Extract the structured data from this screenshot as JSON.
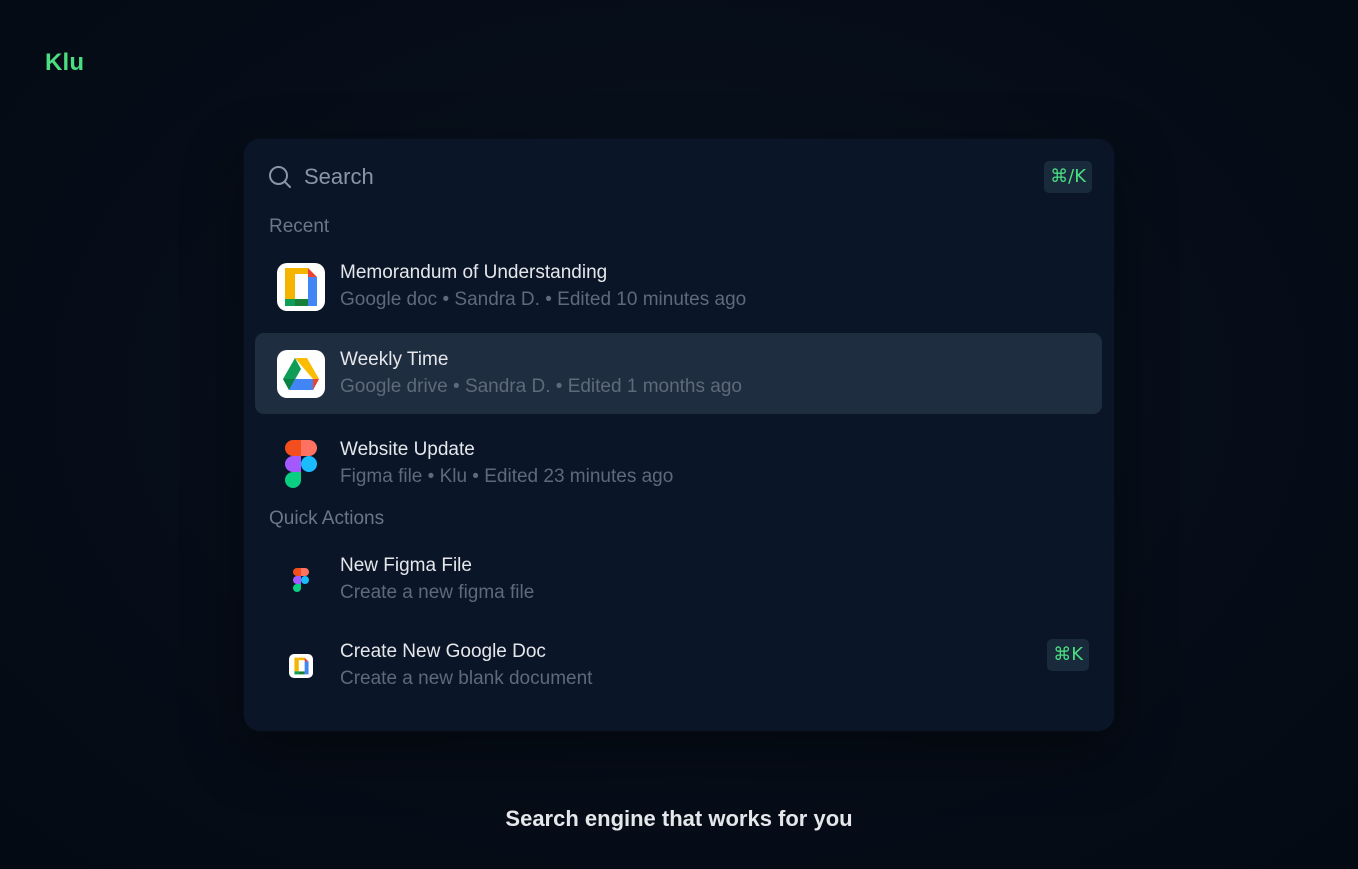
{
  "app": {
    "logo": "Klu",
    "tagline": "Search engine that works for you"
  },
  "colors": {
    "accent": "#4ade80",
    "panel": "#0a1628",
    "selected_row": "#1f2d40"
  },
  "search": {
    "placeholder": "Search",
    "value": "",
    "shortcut": "⌘/K",
    "icon": "search-icon"
  },
  "recent": {
    "label": "Recent",
    "items": [
      {
        "title": "Memorandum of Understanding",
        "subtitle": "Google doc • Sandra D. • Edited 10 minutes ago",
        "icon": "google-docs-icon"
      },
      {
        "title": "Weekly Time",
        "subtitle": "Google drive • Sandra D. • Edited 1 months ago",
        "icon": "google-drive-icon",
        "selected": true
      },
      {
        "title": "Website Update",
        "subtitle": "Figma file • Klu • Edited 23 minutes ago",
        "icon": "figma-icon"
      }
    ]
  },
  "quick_actions": {
    "label": "Quick Actions",
    "items": [
      {
        "title": "New Figma File",
        "subtitle": "Create a new figma file",
        "icon": "figma-icon"
      },
      {
        "title": "Create New Google Doc",
        "subtitle": "Create a new blank document",
        "icon": "google-docs-icon",
        "shortcut": "⌘K"
      }
    ]
  }
}
